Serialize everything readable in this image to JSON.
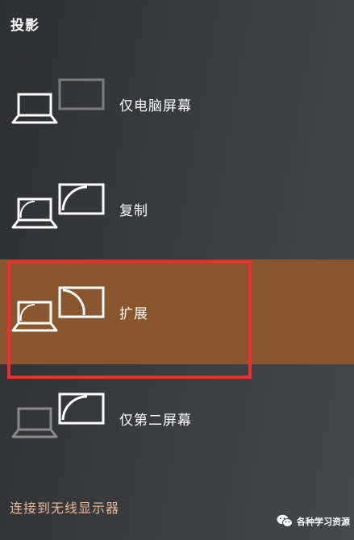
{
  "panel": {
    "title": "投影"
  },
  "options": [
    {
      "label": "仅电脑屏幕",
      "icon": "pc-screen-only-icon",
      "selected": false
    },
    {
      "label": "复制",
      "icon": "duplicate-icon",
      "selected": false
    },
    {
      "label": "扩展",
      "icon": "extend-icon",
      "selected": true
    },
    {
      "label": "仅第二屏幕",
      "icon": "second-screen-only-icon",
      "selected": false
    }
  ],
  "connect_link": "连接到无线显示器",
  "watermark": {
    "text": "各种学习资源",
    "icon": "wechat-icon"
  },
  "colors": {
    "selected_background": "#8a562d",
    "highlight_border": "#e8302d",
    "link": "#e9b899",
    "dimmed_icon": "#8a8a8a"
  }
}
